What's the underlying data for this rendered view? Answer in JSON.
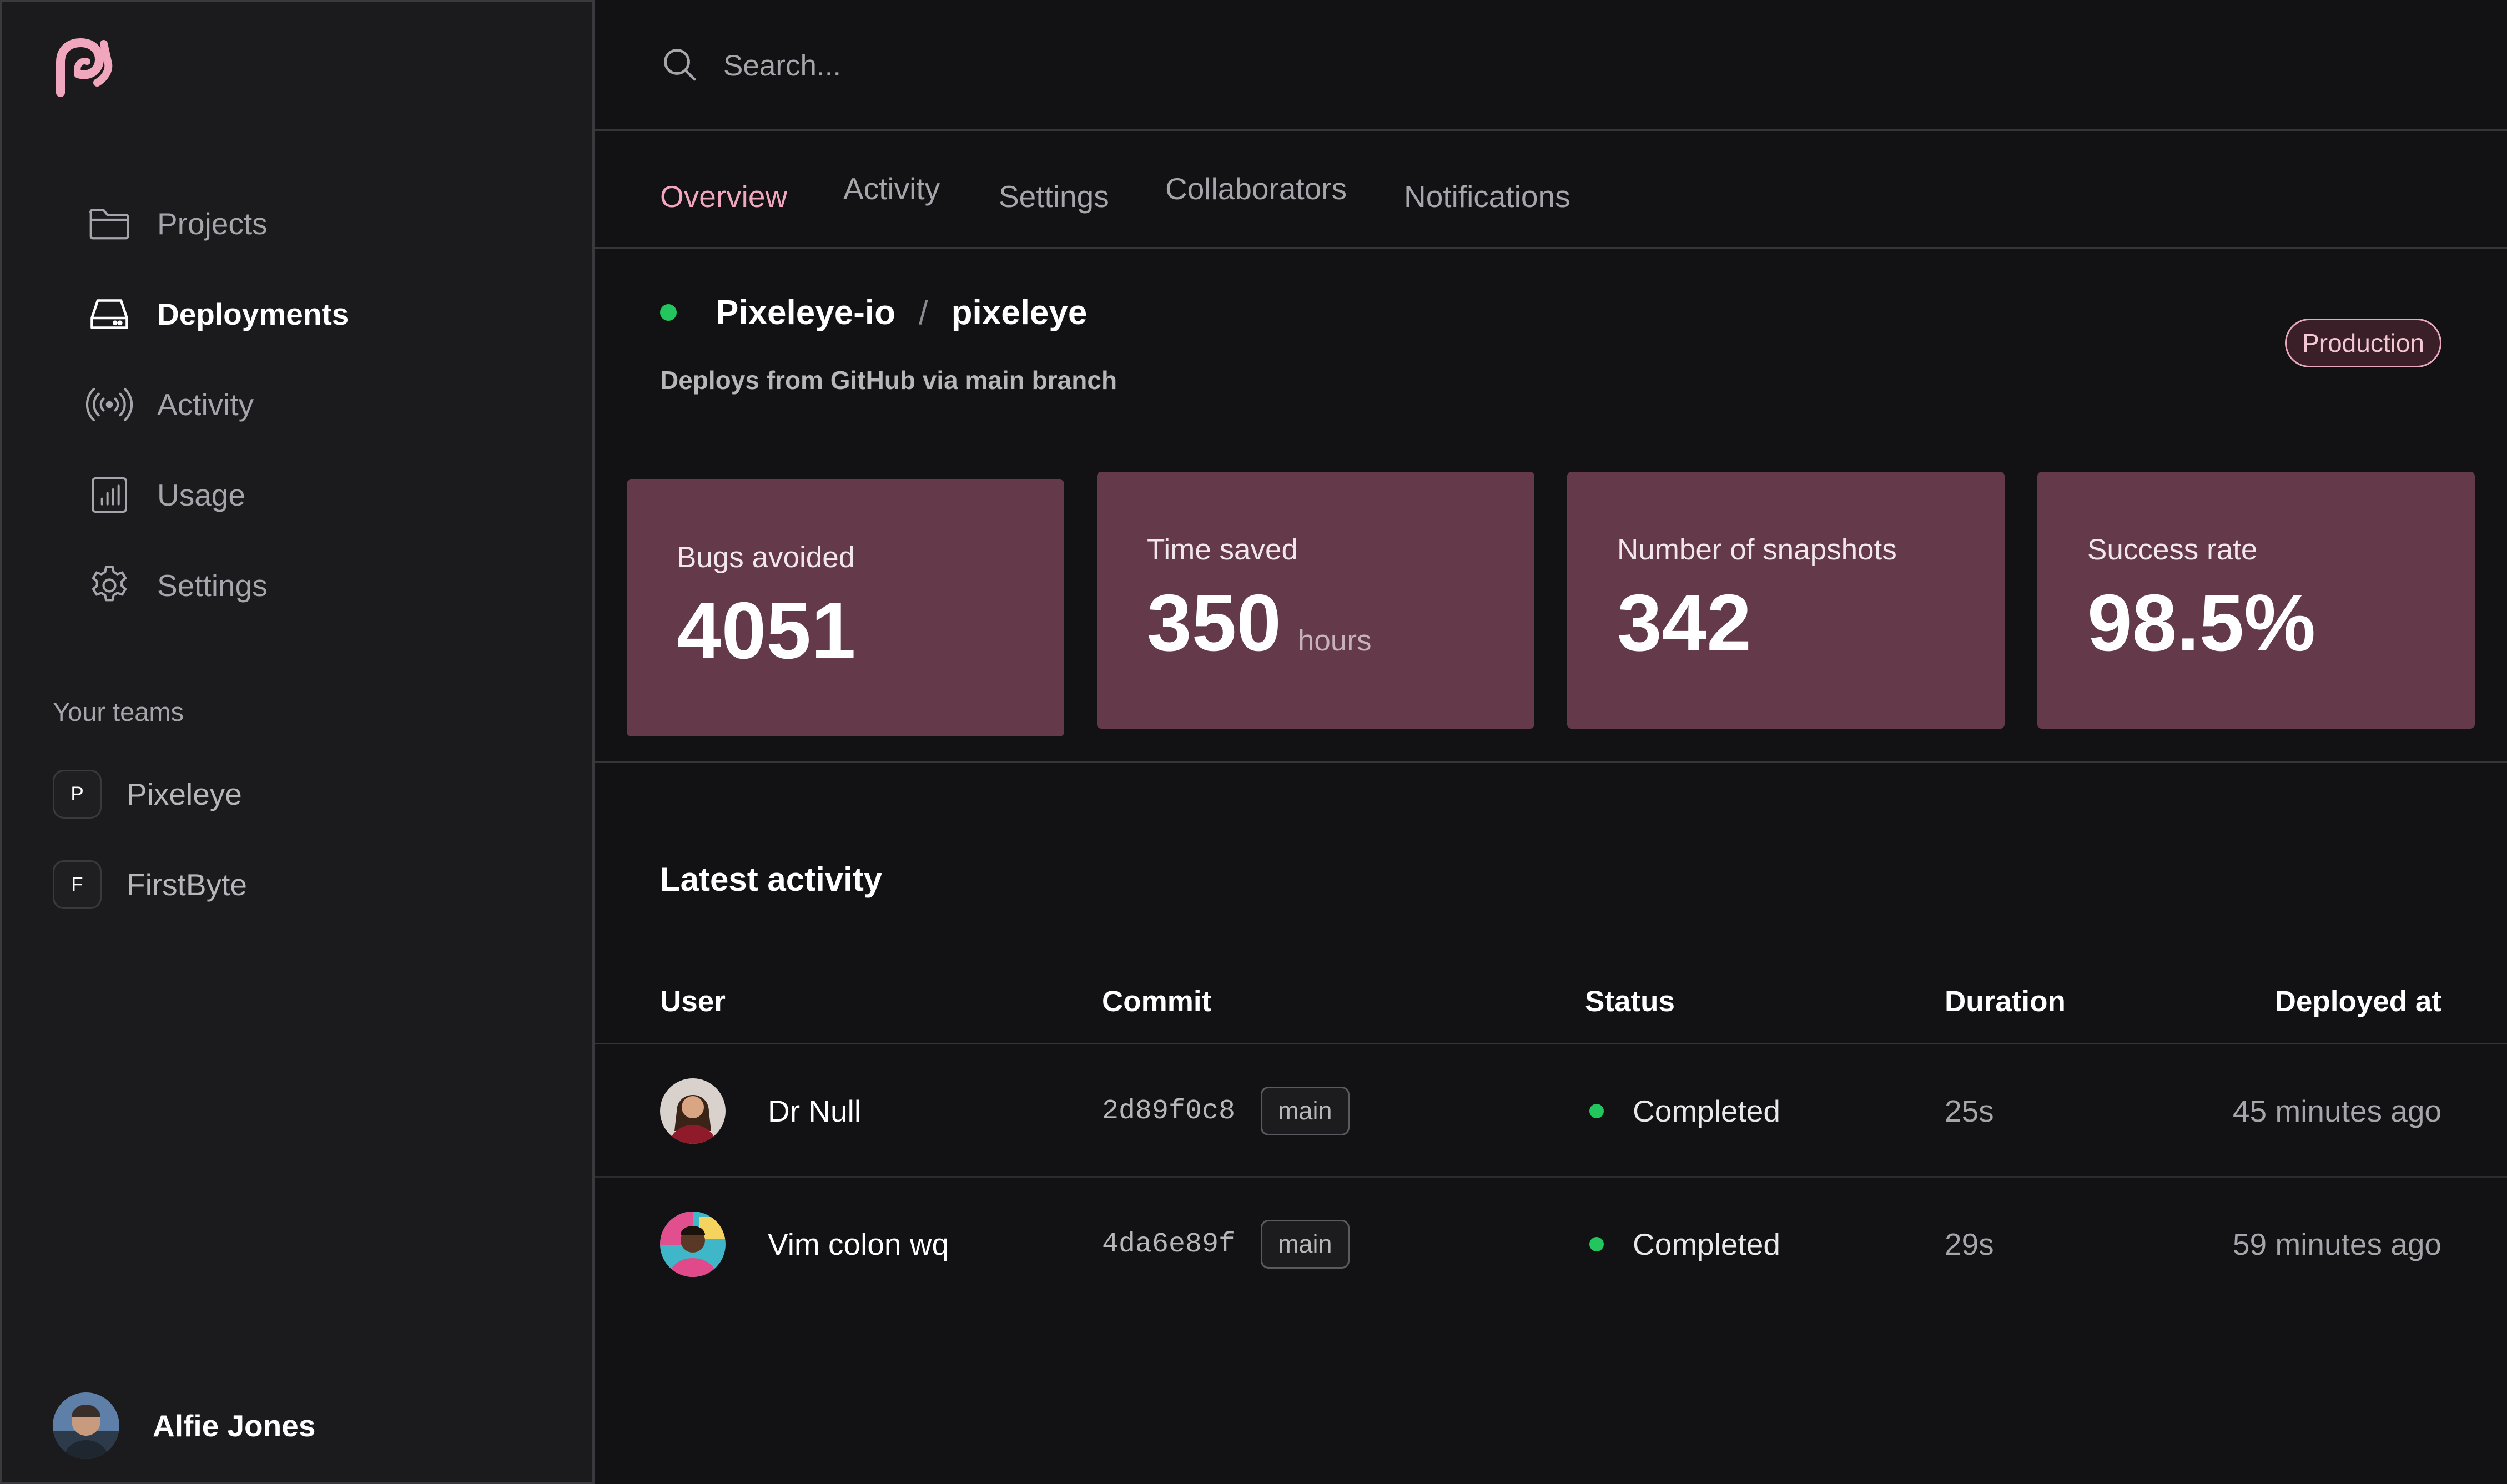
{
  "sidebar": {
    "logo": "pixeleye-logo",
    "nav": [
      {
        "label": "Projects",
        "icon": "folder-icon",
        "active": false
      },
      {
        "label": "Deployments",
        "icon": "server-icon",
        "active": true
      },
      {
        "label": "Activity",
        "icon": "signal-icon",
        "active": false
      },
      {
        "label": "Usage",
        "icon": "chart-icon",
        "active": false
      },
      {
        "label": "Settings",
        "icon": "gear-icon",
        "active": false
      }
    ],
    "teams_title": "Your teams",
    "teams": [
      {
        "initial": "P",
        "name": "Pixeleye"
      },
      {
        "initial": "F",
        "name": "FirstByte"
      }
    ],
    "user": {
      "name": "Alfie Jones"
    }
  },
  "search": {
    "placeholder": "Search..."
  },
  "tabs": [
    {
      "label": "Overview",
      "active": true
    },
    {
      "label": "Activity",
      "active": false
    },
    {
      "label": "Settings",
      "active": false
    },
    {
      "label": "Collaborators",
      "active": false
    },
    {
      "label": "Notifications",
      "active": false
    }
  ],
  "project": {
    "org": "Pixeleye-io",
    "separator": "/",
    "name": "pixeleye",
    "subtitle": "Deploys from GitHub via main branch",
    "environment": "Production",
    "status_color": "#22c55e"
  },
  "stats": [
    {
      "label": "Bugs avoided",
      "value": "4051",
      "unit": ""
    },
    {
      "label": "Time saved",
      "value": "350",
      "unit": "hours"
    },
    {
      "label": "Number of snapshots",
      "value": "342",
      "unit": ""
    },
    {
      "label": "Success rate",
      "value": "98.5%",
      "unit": ""
    }
  ],
  "activity": {
    "title": "Latest activity",
    "columns": [
      "User",
      "Commit",
      "Status",
      "Duration",
      "Deployed at"
    ],
    "rows": [
      {
        "user": "Dr Null",
        "commit": "2d89f0c8",
        "branch": "main",
        "status": "Completed",
        "duration": "25s",
        "deployed_at": "45 minutes ago"
      },
      {
        "user": "Vim colon wq",
        "commit": "4da6e89f",
        "branch": "main",
        "status": "Completed",
        "duration": "29s",
        "deployed_at": "59 minutes ago"
      }
    ]
  },
  "colors": {
    "accent": "#f0a6bd",
    "stat_card": "#643a4a",
    "success": "#22c55e",
    "background": "#121214",
    "sidebar": "#1b1b1e"
  }
}
